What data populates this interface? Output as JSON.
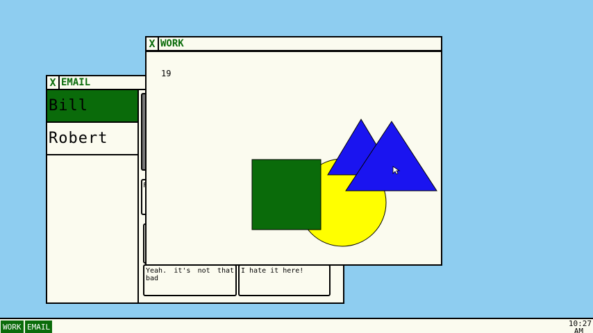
{
  "email_window": {
    "close_label": "X",
    "title": "EMAIL",
    "contacts": [
      {
        "name": "Bill",
        "selected": true
      },
      {
        "name": "Robert",
        "selected": false
      }
    ],
    "messages": [
      {
        "text": "Yeah. it's not that bad"
      },
      {
        "text": "I hate it here!"
      }
    ],
    "partial_label": "F"
  },
  "work_window": {
    "close_label": "X",
    "title": "WORK",
    "counter": "19"
  },
  "shapes": {
    "colors": {
      "green": "#0a6b0a",
      "yellow": "#ffff00",
      "blue": "#1a14f0"
    }
  },
  "taskbar": {
    "buttons": [
      "WORK",
      "EMAIL"
    ],
    "clock_time": "10:27",
    "clock_ampm": "AM"
  },
  "colors": {
    "desktop": "#8ecdf0",
    "window_bg": "#fbfbef",
    "accent": "#0a6b0a"
  }
}
